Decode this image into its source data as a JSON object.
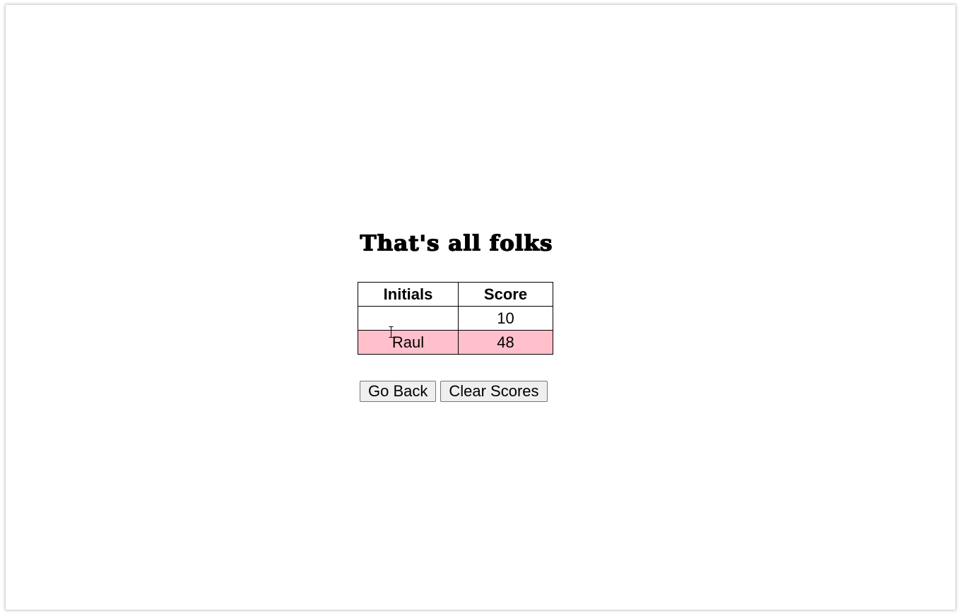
{
  "page": {
    "title": "That's all folks"
  },
  "scoreboard": {
    "headers": {
      "initials": "Initials",
      "score": "Score"
    },
    "rows": [
      {
        "initials": "",
        "score": "10",
        "highlighted": false
      },
      {
        "initials": "Raul",
        "score": "48",
        "highlighted": true
      }
    ],
    "highlight_color": "#ffc0cb"
  },
  "actions": {
    "go_back_label": "Go Back",
    "clear_scores_label": "Clear Scores"
  },
  "cursor": {
    "icon": "text-cursor-icon"
  }
}
